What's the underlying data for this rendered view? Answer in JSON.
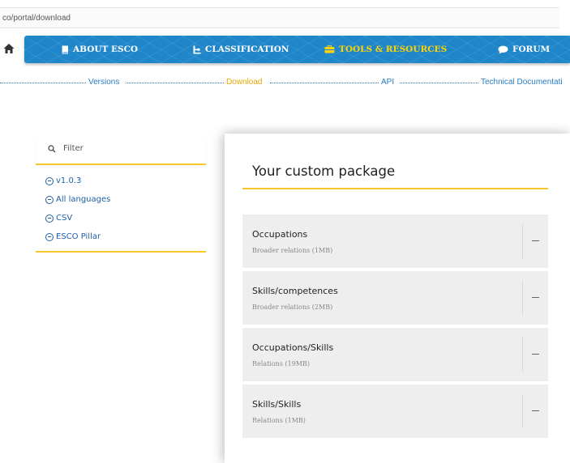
{
  "browser": {
    "url": "co/portal/download"
  },
  "nav": {
    "items": [
      {
        "label": "ABOUT ESCO",
        "icon": "book-icon"
      },
      {
        "label": "CLASSIFICATION",
        "icon": "hierarchy-icon"
      },
      {
        "label": "TOOLS & RESOURCES",
        "icon": "toolbox-icon",
        "active": true
      },
      {
        "label": "FORUM",
        "icon": "chat-icon"
      }
    ]
  },
  "subnav": {
    "items": [
      {
        "label": "Versions"
      },
      {
        "label": "Download",
        "active": true
      },
      {
        "label": "API"
      },
      {
        "label": "Technical Documentati"
      }
    ]
  },
  "filter": {
    "placeholder": "Filter",
    "items": [
      {
        "label": "v1.0.3"
      },
      {
        "label": "All languages"
      },
      {
        "label": "CSV"
      },
      {
        "label": "ESCO Pillar"
      }
    ]
  },
  "package": {
    "title": "Your custom package",
    "items": [
      {
        "name": "Occupations",
        "detail": "Broader relations (1MB)"
      },
      {
        "name": "Skills/competences",
        "detail": "Broader relations (2MB)"
      },
      {
        "name": "Occupations/Skills",
        "detail": "Relations (19MB)"
      },
      {
        "name": "Skills/Skills",
        "detail": "Relations (1MB)"
      }
    ]
  },
  "colors": {
    "nav_blue": "#1f86c9",
    "active_yellow": "#ffd400",
    "accent_yellow": "#f4c82c",
    "link_blue": "#2a7bbf"
  }
}
